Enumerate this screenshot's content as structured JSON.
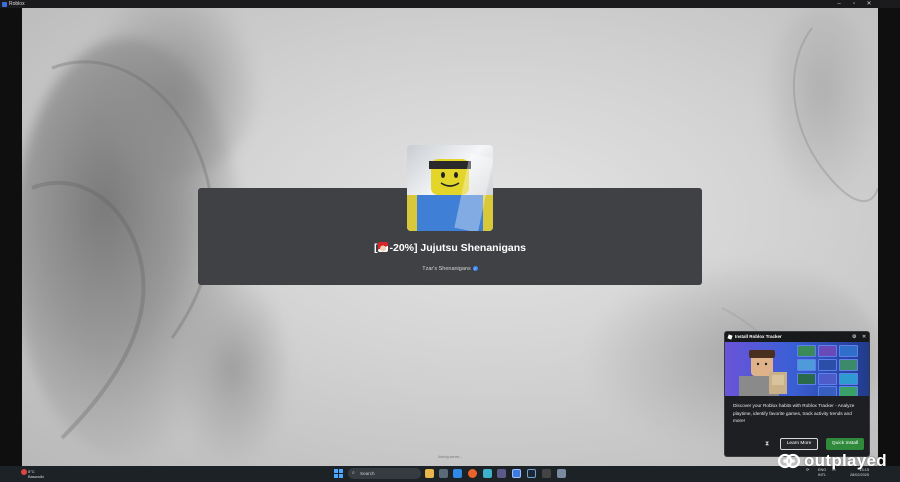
{
  "window": {
    "title": "Roblox"
  },
  "game": {
    "title_prefix": "[",
    "title_suffix": "-20%] Jujutsu Shenanigans",
    "creator": "Tzar's Shenanigans",
    "status": "Joining server..."
  },
  "popup": {
    "title": "Install Roblox Tracker",
    "description": "Discover your Roblox habits with Roblox Tracker - Analyze playtime, identify favorite games, track activity trends and more!",
    "learn_more": "Learn More",
    "quick_install": "Quick Install"
  },
  "taskbar": {
    "weather_temp": "5°C",
    "weather_desc": "Baswolki",
    "search_placeholder": "Search",
    "lang": "ENG",
    "lang_sub": "INTL",
    "time": "15:15",
    "date": "28/02/2025"
  },
  "watermark": {
    "text": "outplayed"
  },
  "colors": {
    "card_bg": "#404144",
    "install_green": "#2f8a3b",
    "popup_bg": "#1e1f22",
    "taskbar_bg": "#1d2226"
  },
  "icons": [
    "roblox-icon",
    "minimize-icon",
    "maximize-icon",
    "close-icon",
    "verified-icon",
    "gear-icon",
    "hourglass-icon",
    "windows-start-icon",
    "search-icon"
  ]
}
